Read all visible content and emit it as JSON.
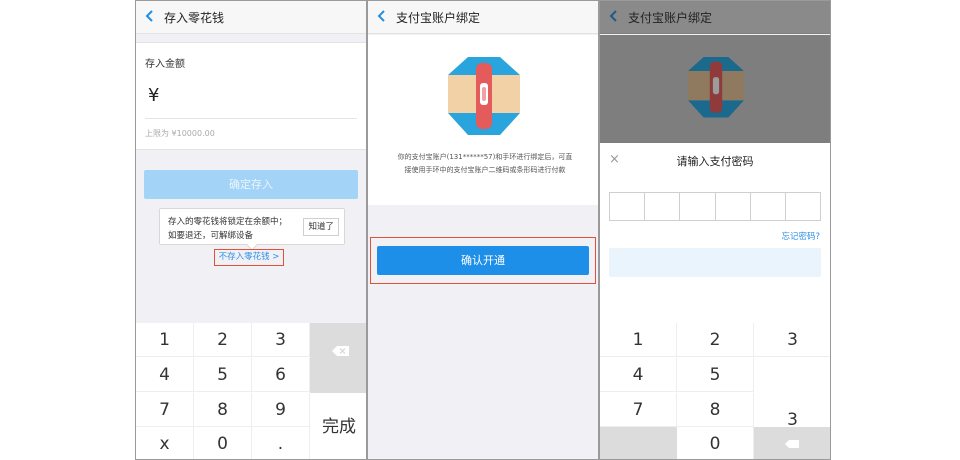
{
  "panel1": {
    "title": "存入零花钱",
    "amount_label": "存入金额",
    "currency": "¥",
    "limit": "上限为 ¥10000.00",
    "confirm": "确定存入",
    "tip_line1": "存入的零花钱将锁定在余额中；",
    "tip_line2": "如要退还，可解绑设备",
    "tip_ok": "知道了",
    "no_store": "不存入零花钱 >",
    "keys": [
      "1",
      "2",
      "3",
      "4",
      "5",
      "6",
      "7",
      "8",
      "9",
      "x",
      "0",
      "."
    ],
    "done": "完成"
  },
  "panel2": {
    "title": "支付宝账户绑定",
    "desc_line1": "你的支付宝账户(131******57)和手环进行绑定后，可直",
    "desc_line2": "接使用手环中的支付宝账户二维码或条形码进行付款",
    "confirm": "确认开通"
  },
  "panel3": {
    "title": "支付宝账户绑定",
    "close": "×",
    "sheet_title": "请输入支付密码",
    "forgot": "忘记密码?",
    "keys": [
      "1",
      "2",
      "3",
      "4",
      "5",
      "7",
      "8",
      "3",
      "0"
    ]
  },
  "colors": {
    "accent": "#1e8fe8",
    "highlight_border": "#e0503a",
    "link": "#2d8fe6"
  },
  "icons": [
    "back-arrow-icon",
    "backspace-icon",
    "band-illustration",
    "close-icon"
  ]
}
